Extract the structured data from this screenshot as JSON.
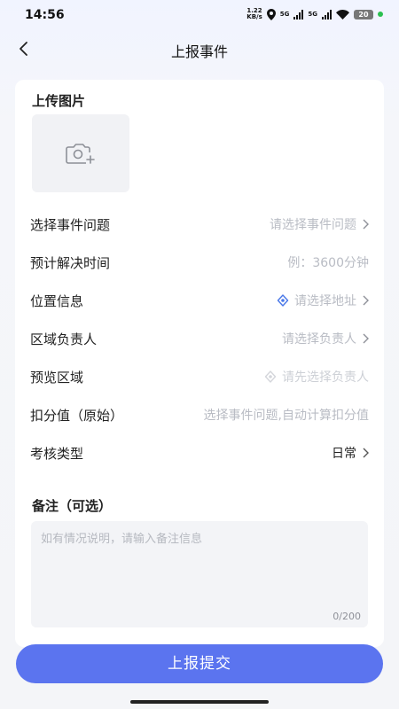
{
  "status": {
    "time": "14:56",
    "net_speed_top": "1.22",
    "net_speed_unit": "KB/s",
    "signal1_label": "5G",
    "signal2_label": "5G",
    "battery": "20"
  },
  "header": {
    "title": "上报事件"
  },
  "upload": {
    "title": "上传图片",
    "icon": "camera-add-icon"
  },
  "form": {
    "rows": [
      {
        "label": "选择事件问题",
        "value": "请选择事件问题",
        "chevron": true
      },
      {
        "label": "预计解决时间",
        "value": "例：3600分钟",
        "chevron": false
      },
      {
        "label": "位置信息",
        "value": "请选择地址",
        "chevron": true,
        "icon": "location-icon"
      },
      {
        "label": "区域负责人",
        "value": "请选择负责人",
        "chevron": true
      },
      {
        "label": "预览区域",
        "value": "请先选择负责人",
        "chevron": false,
        "icon": "location-icon"
      },
      {
        "label": "扣分值（原始）",
        "value": "选择事件问题,自动计算扣分值",
        "chevron": false
      },
      {
        "label": "考核类型",
        "value": "日常",
        "chevron": true
      }
    ]
  },
  "remark": {
    "title": "备注（可选）",
    "placeholder": "如有情况说明，请输入备注信息",
    "count": "0/200"
  },
  "submit_label": "上报提交",
  "colors": {
    "accent": "#5b74ef",
    "location_icon": "#4a78e8"
  }
}
